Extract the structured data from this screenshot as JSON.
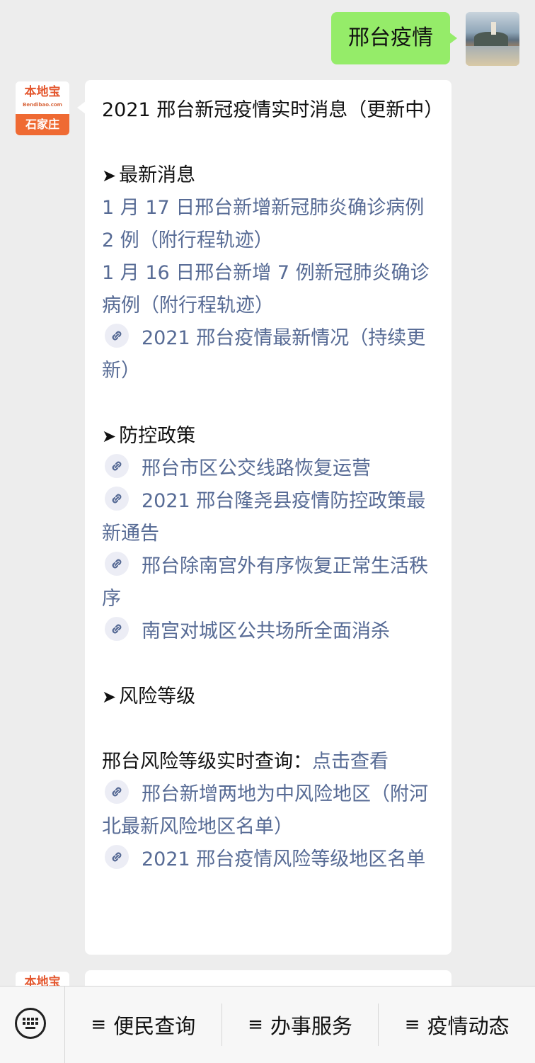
{
  "user_message": {
    "text": "邢台疫情"
  },
  "bot": {
    "avatar": {
      "logo": "本地宝",
      "logo_small": "Bendibao.com",
      "city": "石家庄"
    }
  },
  "article": {
    "title": "2021 邢台新冠疫情实时消息（更新中）",
    "sections": {
      "latest": {
        "heading": "最新消息",
        "items": [
          "1 月 17 日邢台新增新冠肺炎确诊病例 2 例（附行程轨迹）",
          "1 月 16 日邢台新增 7 例新冠肺炎确诊病例（附行程轨迹）",
          "2021 邢台疫情最新情况（持续更新）"
        ]
      },
      "policy": {
        "heading": "防控政策",
        "items": [
          "邢台市区公交线路恢复运营",
          "2021 邢台隆尧县疫情防控政策最新通告",
          "邢台除南宫外有序恢复正常生活秩序",
          "南宫对城区公共场所全面消杀"
        ]
      },
      "risk": {
        "heading": "风险等级",
        "query_text": "邢台风险等级实时查询：",
        "query_link": "点击查看",
        "items": [
          "邢台新增两地为中风险地区（附河北最新风险地区名单）",
          "2021 邢台疫情风险等级地区名单"
        ]
      }
    }
  },
  "menu": {
    "keyboard_icon": "keyboard-icon",
    "items": [
      "便民查询",
      "办事服务",
      "疫情动态"
    ]
  },
  "colors": {
    "user_bubble": "#95ec69",
    "link": "#576b95",
    "background": "#ededed"
  }
}
